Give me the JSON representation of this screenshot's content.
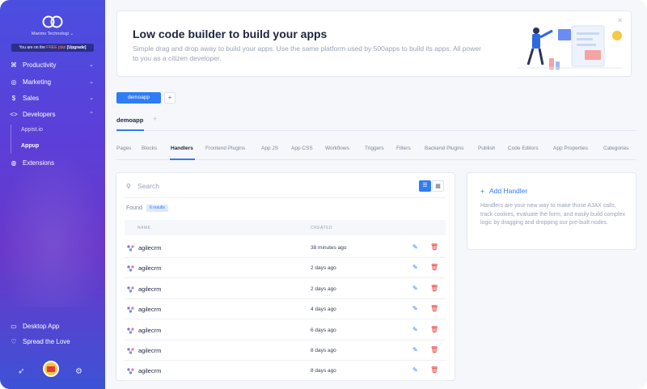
{
  "sidebar": {
    "org_name": "Manmo Technologi",
    "plan_prefix": "You are on the",
    "plan_name": "FREE plan",
    "plan_upgrade": "[Upgrade]",
    "nav": [
      {
        "label": "Productivity",
        "icon": "command-icon"
      },
      {
        "label": "Marketing",
        "icon": "target-icon"
      },
      {
        "label": "Sales",
        "icon": "dollar-icon"
      },
      {
        "label": "Developers",
        "icon": "code-icon"
      }
    ],
    "developers_sub": [
      "Appist.io",
      "Appup"
    ],
    "extensions": "Extensions",
    "desktop_app": "Desktop App",
    "spread_love": "Spread the Love"
  },
  "hero": {
    "title": "Low code builder to build your apps",
    "description": "Simple drag and drop away to build your apps. Use the same platform used by 500apps to build its apps. All power to you as a citizen developer."
  },
  "app_button": "demoapp",
  "app_tab": "demoapp",
  "tabs": [
    "Pages",
    "Blocks",
    "Handlers",
    "Frontend Plugins",
    "App JS",
    "App CSS",
    "Workflows",
    "Triggers",
    "Filters",
    "Backend Plugins",
    "Publish",
    "Code Editors",
    "App Properties",
    "Categories"
  ],
  "active_tab": "Handlers",
  "search": {
    "placeholder": "Search"
  },
  "found_label": "Found",
  "found_badge": "6 results",
  "table": {
    "columns": [
      "NAME",
      "CREATED"
    ],
    "rows": [
      {
        "name": "agilecrm",
        "created": "38 minutes ago"
      },
      {
        "name": "agilecrm",
        "created": "2 days ago"
      },
      {
        "name": "agilecrm",
        "created": "2 days ago"
      },
      {
        "name": "agilecrm",
        "created": "4 days ago"
      },
      {
        "name": "agilecrm",
        "created": "6 days ago"
      },
      {
        "name": "agilecrm",
        "created": "8 days ago"
      },
      {
        "name": "agilecrm",
        "created": "8 days ago"
      }
    ]
  },
  "side_panel": {
    "add_label": "Add Handler",
    "description": "Handlers are your new way to make those AJAX calls, track cookies, evaluate the form, and easily build complex logic by dragging and dropping our pre-built nodes."
  },
  "colors": {
    "accent": "#2f7cf6",
    "delete": "#e53935",
    "sidebar_top": "#4a4fe0",
    "sidebar_bottom": "#3d52d6"
  }
}
